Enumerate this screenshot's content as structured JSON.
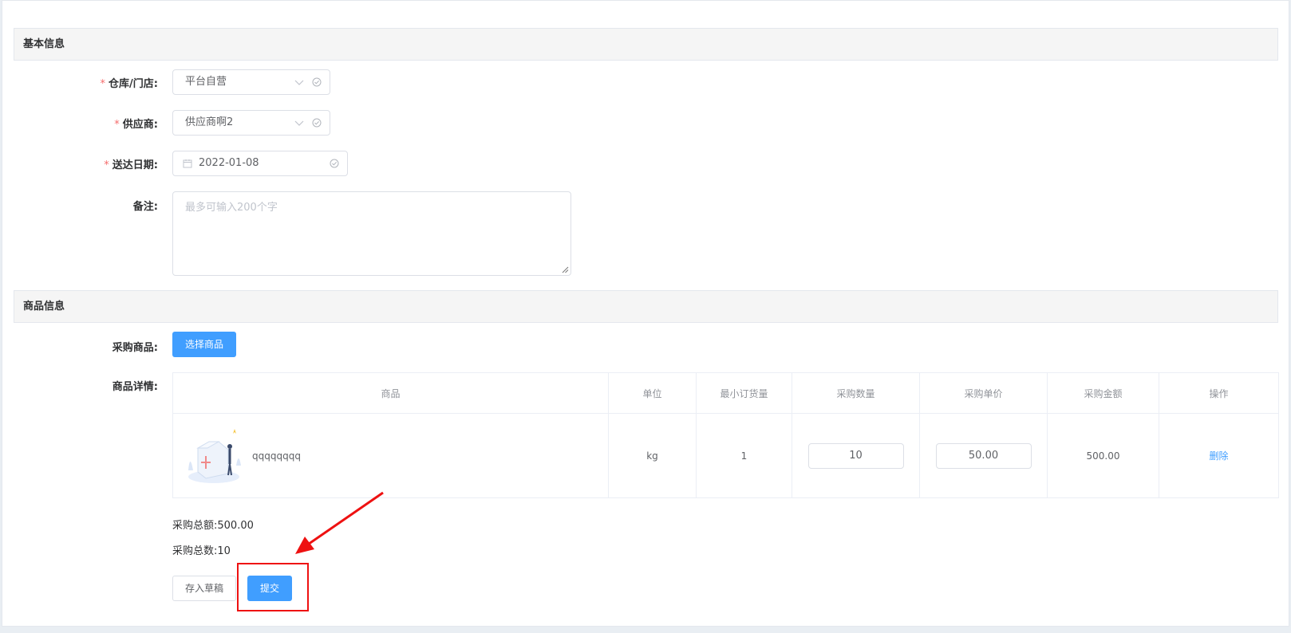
{
  "sections": {
    "basic": "基本信息",
    "goods": "商品信息"
  },
  "form": {
    "warehouse": {
      "label": "仓库/门店:",
      "value": "平台自营",
      "required_mark": "*"
    },
    "supplier": {
      "label": "供应商:",
      "value": "供应商啊2",
      "required_mark": "*"
    },
    "delivery_date": {
      "label": "送达日期:",
      "value": "2022-01-08",
      "required_mark": "*"
    },
    "remark": {
      "label": "备注:",
      "placeholder": "最多可输入200个字"
    },
    "purchase_goods": {
      "label": "采购商品:",
      "button": "选择商品"
    },
    "goods_detail": {
      "label": "商品详情:"
    }
  },
  "table": {
    "headers": [
      "商品",
      "单位",
      "最小订货量",
      "采购数量",
      "采购单价",
      "采购金额",
      "操作"
    ],
    "rows": [
      {
        "product": "qqqqqqqq",
        "unit": "kg",
        "min_order": "1",
        "qty": "10",
        "price": "50.00",
        "amount": "500.00",
        "action": "删除"
      }
    ]
  },
  "summary": {
    "total_amount_label": "采购总额:",
    "total_amount": "500.00",
    "total_count_label": "采购总数:",
    "total_count": "10"
  },
  "actions": {
    "draft": "存入草稿",
    "submit": "提交"
  },
  "colors": {
    "primary": "#409eff",
    "required": "#f56c6c",
    "annotation": "#ee1111"
  },
  "icons": {
    "select_arrow": "chevron-down-icon",
    "valid": "circle-check-icon",
    "date": "calendar-icon"
  }
}
